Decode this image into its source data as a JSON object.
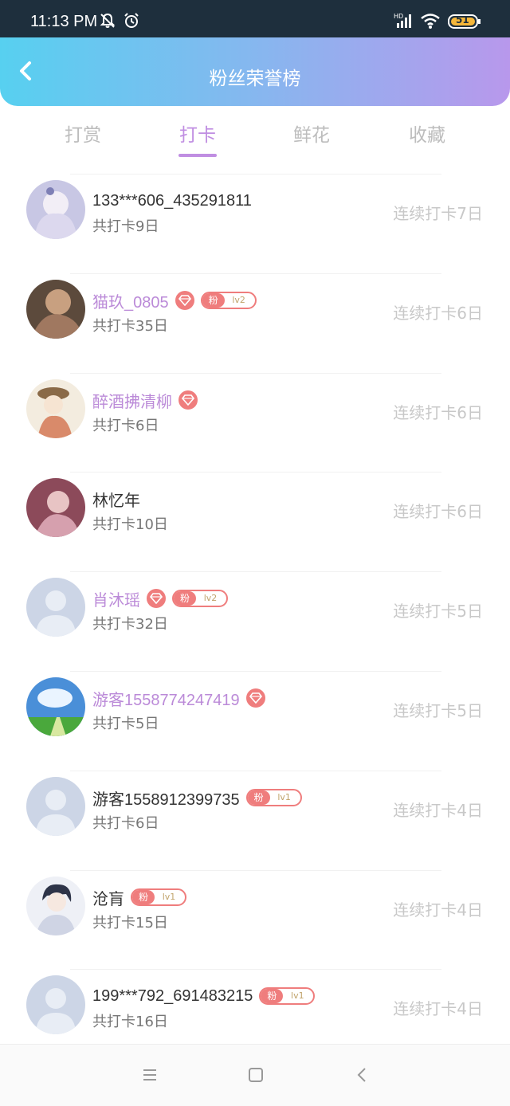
{
  "status_bar": {
    "time": "11:13 PM",
    "battery": "51",
    "icons": [
      "bell-off-icon",
      "alarm-icon",
      "signal-icon",
      "wifi-icon",
      "battery-icon"
    ]
  },
  "header": {
    "title": "粉丝荣誉榜",
    "back_icon": "chevron-left-icon"
  },
  "tabs": [
    {
      "label": "打赏",
      "active": false
    },
    {
      "label": "打卡",
      "active": true
    },
    {
      "label": "鲜花",
      "active": false
    },
    {
      "label": "收藏",
      "active": false
    }
  ],
  "badges": {
    "fan_label": "粉",
    "diamond_icon": "diamond-icon"
  },
  "colors": {
    "accent": "#c08ee2",
    "badge": "#ef7d7d",
    "header_gradient": [
      "#57d0f0",
      "#b898ec"
    ]
  },
  "rows": [
    {
      "name": "133***606_435291811",
      "total": "共打卡9日",
      "streak": "连续打卡7日",
      "highlight": false,
      "diamond": false,
      "fan_level": null,
      "avatar": "anime-girl-white"
    },
    {
      "name": "猫玖_0805",
      "total": "共打卡35日",
      "streak": "连续打卡6日",
      "highlight": true,
      "diamond": true,
      "fan_level": "lv2",
      "avatar": "photo-girl"
    },
    {
      "name": "醉酒拂清柳",
      "total": "共打卡6日",
      "streak": "连续打卡6日",
      "highlight": true,
      "diamond": true,
      "fan_level": null,
      "avatar": "anime-girl-hat"
    },
    {
      "name": "林忆年",
      "total": "共打卡10日",
      "streak": "连续打卡6日",
      "highlight": false,
      "diamond": false,
      "fan_level": null,
      "avatar": "photo-pink"
    },
    {
      "name": "肖沐瑶",
      "total": "共打卡32日",
      "streak": "连续打卡5日",
      "highlight": true,
      "diamond": true,
      "fan_level": "lv2",
      "avatar": "default"
    },
    {
      "name": "游客1558774247419",
      "total": "共打卡5日",
      "streak": "连续打卡5日",
      "highlight": true,
      "diamond": true,
      "fan_level": null,
      "avatar": "sky-field"
    },
    {
      "name": "游客1558912399735",
      "total": "共打卡6日",
      "streak": "连续打卡4日",
      "highlight": false,
      "diamond": false,
      "fan_level": "lv1",
      "avatar": "default"
    },
    {
      "name": "沧肓",
      "total": "共打卡15日",
      "streak": "连续打卡4日",
      "highlight": false,
      "diamond": false,
      "fan_level": "lv1",
      "avatar": "anime-boy"
    },
    {
      "name": "199***792_691483215",
      "total": "共打卡16日",
      "streak": "连续打卡4日",
      "highlight": false,
      "diamond": false,
      "fan_level": "lv1",
      "avatar": "default"
    }
  ],
  "nav_bar": {
    "buttons": [
      "menu-icon",
      "home-icon",
      "back-icon"
    ]
  }
}
